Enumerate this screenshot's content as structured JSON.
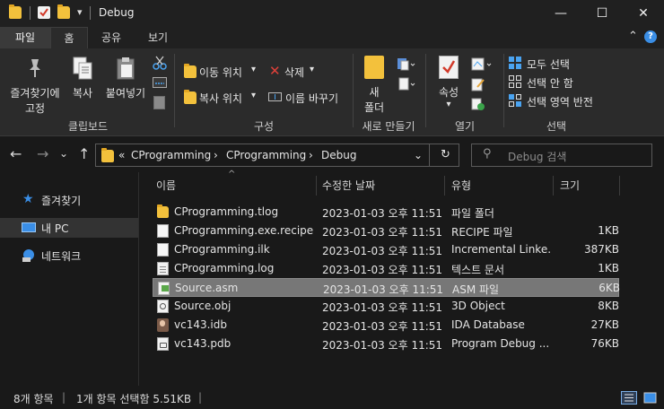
{
  "window": {
    "title": "Debug",
    "dropdown_glyph": "▾",
    "minimize_glyph": "—",
    "maximize_glyph": "☐",
    "close_glyph": "✕"
  },
  "ribbon_tabs": {
    "file": "파일",
    "home": "홈",
    "share": "공유",
    "view": "보기",
    "collapse_glyph": "⌃",
    "help_glyph": "?"
  },
  "ribbon": {
    "clipboard": {
      "group_label": "클립보드",
      "pin_label_1": "즐겨찾기에",
      "pin_label_2": "고정",
      "copy_label": "복사",
      "paste_label": "붙여넣기"
    },
    "organize": {
      "group_label": "구성",
      "move_to": "이동 위치",
      "copy_to": "복사 위치",
      "delete": "삭제",
      "rename": "이름 바꾸기",
      "dropdown_glyph": "▾"
    },
    "new": {
      "group_label": "새로 만들기",
      "new_folder_1": "새",
      "new_folder_2": "폴더"
    },
    "open": {
      "group_label": "열기",
      "properties": "속성",
      "dropdown_glyph": "▾"
    },
    "select": {
      "group_label": "선택",
      "select_all": "모두 선택",
      "select_none": "선택 안 함",
      "invert": "선택 영역 반전"
    }
  },
  "navigation": {
    "back_glyph": "←",
    "forward_glyph": "→",
    "history_glyph": "⌄",
    "up_glyph": "↑",
    "overflow_glyph": "«",
    "crumb_sep": "›",
    "breadcrumb": [
      "CProgramming",
      "CProgramming",
      "Debug"
    ],
    "address_dropdown_glyph": "⌄",
    "refresh_glyph": "↻",
    "search_glyph": "⚲",
    "search_placeholder": "Debug 검색"
  },
  "nav_pane": {
    "items": [
      {
        "label": "즐겨찾기",
        "icon": "star-icon"
      },
      {
        "label": "내 PC",
        "icon": "pc-icon"
      },
      {
        "label": "네트워크",
        "icon": "network-icon"
      }
    ]
  },
  "columns": {
    "name": "이름",
    "date": "수정한 날짜",
    "type": "유형",
    "size": "크기",
    "sort_glyph": "^"
  },
  "files": [
    {
      "name": "CProgramming.tlog",
      "date": "2023-01-03 오후 11:51",
      "type": "파일 폴더",
      "size": "",
      "icon": "folder-icon"
    },
    {
      "name": "CProgramming.exe.recipe",
      "date": "2023-01-03 오후 11:51",
      "type": "RECIPE 파일",
      "size": "1KB",
      "icon": "blank-file-icon"
    },
    {
      "name": "CProgramming.ilk",
      "date": "2023-01-03 오후 11:51",
      "type": "Incremental Linke...",
      "size": "387KB",
      "icon": "blank-file-icon"
    },
    {
      "name": "CProgramming.log",
      "date": "2023-01-03 오후 11:51",
      "type": "텍스트 문서",
      "size": "1KB",
      "icon": "text-file-icon"
    },
    {
      "name": "Source.asm",
      "date": "2023-01-03 오후 11:51",
      "type": "ASM 파일",
      "size": "6KB",
      "icon": "asm-file-icon"
    },
    {
      "name": "Source.obj",
      "date": "2023-01-03 오후 11:51",
      "type": "3D Object",
      "size": "8KB",
      "icon": "obj-file-icon"
    },
    {
      "name": "vc143.idb",
      "date": "2023-01-03 오후 11:51",
      "type": "IDA Database",
      "size": "27KB",
      "icon": "ida-file-icon"
    },
    {
      "name": "vc143.pdb",
      "date": "2023-01-03 오후 11:51",
      "type": "Program Debug ...",
      "size": "76KB",
      "icon": "pdb-file-icon"
    }
  ],
  "selected_index": 4,
  "status": {
    "item_count": "8개 항목",
    "selection": "1개 항목 선택함 5.51KB",
    "bar_glyph": "|"
  },
  "colors": {
    "background": "#191919",
    "ribbon": "#2b2b2b",
    "selected_row": "#777777",
    "folder": "#f3c13c",
    "accent_blue": "#3a8ee6"
  }
}
